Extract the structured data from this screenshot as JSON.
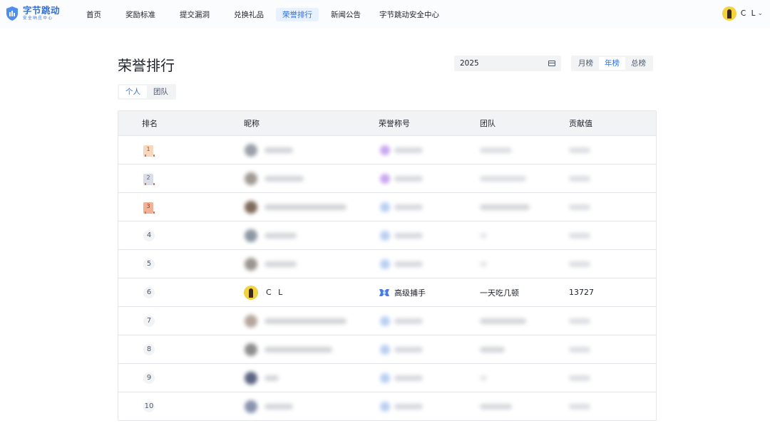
{
  "brand": {
    "name": "字节跳动",
    "sub": "安全响应中心",
    "accent": "#2f6fe0"
  },
  "nav": [
    {
      "label": "首页"
    },
    {
      "label": "奖励标准"
    },
    {
      "label": "提交漏洞"
    },
    {
      "label": "兑换礼品"
    },
    {
      "label": "荣誉排行",
      "active": true
    },
    {
      "label": "新闻公告"
    },
    {
      "label": "字节跳动安全中心"
    }
  ],
  "user": {
    "name": "C L"
  },
  "page": {
    "title": "荣誉排行"
  },
  "filters": {
    "year": "2025",
    "period_tabs": [
      "月榜",
      "年榜",
      "总榜"
    ],
    "period_active": "年榜",
    "scope_tabs": [
      "个人",
      "团队"
    ],
    "scope_active": "个人"
  },
  "table": {
    "headers": [
      "排名",
      "昵称",
      "荣誉称号",
      "团队",
      "贡献值"
    ],
    "current_user_row": {
      "rank": "6",
      "nickname": "C L",
      "honor": "高级捕手",
      "team": "一天吃几顿",
      "score": "13727"
    },
    "ranks": [
      "1",
      "2",
      "3",
      "4",
      "5",
      "6",
      "7",
      "8",
      "9",
      "10"
    ]
  }
}
